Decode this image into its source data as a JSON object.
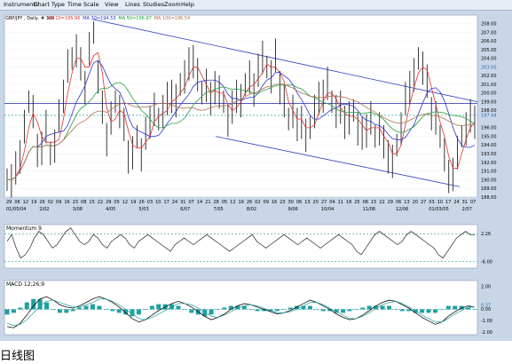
{
  "menu": [
    "Instruments",
    "Chart Type",
    "Time Scale",
    "View",
    "Lines",
    "Studies",
    "Zoom",
    "Help"
  ],
  "caption": "日线图",
  "chart_data": [
    {
      "type": "line",
      "title": "GBP/JPY , Daily, # 300",
      "legend": [
        {
          "label": "MA 10=195.96",
          "color": "#e03030"
        },
        {
          "label": "MA 30=194.53",
          "color": "#3030d0"
        },
        {
          "label": "MA 50=196.97",
          "color": "#20a040"
        },
        {
          "label": "MA 100=196.54",
          "color": "#b07050"
        }
      ],
      "price_ticks": [
        "208.00",
        "207.00",
        "206.00",
        "205.00",
        "204.00",
        "203.00",
        "202.00",
        "201.00",
        "200.00",
        "199.00",
        "198.00",
        "197.44",
        "196.00",
        "195.00",
        "194.00",
        "193.00",
        "192.00",
        "191.00",
        "190.00",
        "189.00",
        "188.00"
      ],
      "price_tick_values": [
        208,
        207,
        206,
        205,
        204,
        203,
        202,
        201,
        200,
        199,
        198,
        197.44,
        196,
        195,
        194,
        193,
        192,
        191,
        190,
        189,
        188
      ],
      "highlight_ticks": [
        "203.00",
        "197.44"
      ],
      "ylim": [
        188,
        209
      ],
      "x_ticks_days": [
        "29",
        "06",
        "12",
        "19",
        "26",
        "02",
        "09",
        "16",
        "23",
        "08",
        "15",
        "22",
        "29",
        "05",
        "12",
        "19",
        "26",
        "03",
        "10",
        "17",
        "24",
        "31",
        "07",
        "14",
        "21",
        "28",
        "05",
        "12",
        "19",
        "26",
        "02",
        "09",
        "16",
        "23",
        "30",
        "06",
        "13",
        "20",
        "27",
        "04",
        "11",
        "18",
        "25",
        "08",
        "15",
        "22",
        "29",
        "06",
        "13",
        "20",
        "27",
        "03",
        "10",
        "17",
        "24",
        "31",
        "07"
      ],
      "x_ticks_months": [
        "01/05/04",
        "2/02",
        "3/08",
        "4/05",
        "5/03",
        "6/07",
        "7/05",
        "8/02",
        "9/06",
        "10/04",
        "11/08",
        "12/06",
        "01/03/05",
        "2/07"
      ],
      "close_path": [
        190,
        190,
        191,
        193,
        196,
        199,
        198,
        193,
        194,
        196,
        193,
        194,
        197,
        200,
        203,
        204,
        205,
        203,
        201,
        205,
        207,
        202,
        198,
        195,
        197,
        199,
        198,
        196,
        193,
        193,
        195,
        193,
        195,
        197,
        198,
        197,
        198,
        199,
        200,
        199,
        201,
        202,
        203,
        204,
        202,
        200,
        201,
        199,
        201,
        200,
        199,
        197,
        198,
        200,
        199,
        201,
        202,
        200,
        203,
        204,
        203,
        202,
        204,
        201,
        199,
        197,
        198,
        196,
        197,
        195,
        196,
        198,
        199,
        200,
        201,
        199,
        198,
        198,
        197,
        197,
        198,
        196,
        195,
        196,
        197,
        195,
        196,
        194,
        193,
        192,
        194,
        196,
        199,
        201,
        202,
        204,
        203,
        201,
        198,
        197,
        195,
        193,
        190,
        191,
        193,
        195,
        196,
        197,
        197
      ],
      "channel_upper": [
        [
          0,
          208.5
        ],
        [
          1,
          199.0
        ]
      ],
      "channel_lower": [
        [
          0,
          195.0
        ],
        [
          1,
          189.2
        ]
      ],
      "horizontal_lines": [
        198.8,
        197.44
      ]
    },
    {
      "type": "line",
      "title": "Momentum 9",
      "ticks": [
        "2.26",
        "-6.00"
      ],
      "tick_values": [
        2.26,
        -6.0
      ],
      "ylim": [
        -8,
        5
      ],
      "values": [
        0,
        2,
        -2,
        -5,
        -4,
        -2,
        1,
        3,
        2,
        0,
        -2,
        -1,
        1,
        3,
        4,
        2,
        0,
        -1,
        0,
        2,
        1,
        -1,
        -2,
        0,
        1,
        2,
        1,
        -1,
        -2,
        0,
        1,
        2,
        1,
        0,
        -1,
        -2,
        -3,
        -1,
        0,
        1,
        0,
        -1,
        0,
        1,
        2,
        1,
        0,
        -1,
        -2,
        -3,
        -2,
        -1,
        0,
        1,
        2,
        0,
        -1,
        -2,
        -1,
        0,
        1,
        2,
        1,
        0,
        -1,
        0,
        1,
        0,
        -1,
        -2,
        -1,
        0,
        1,
        2,
        1,
        0,
        -1,
        -3,
        -4,
        -2,
        0,
        2,
        3,
        2,
        1,
        0,
        -1,
        0,
        2,
        3,
        2,
        1,
        0,
        -1,
        -2,
        -4,
        -5,
        -3,
        -1,
        1,
        2,
        3,
        2,
        2
      ]
    },
    {
      "type": "line",
      "title": "MACD 12;26;9",
      "ticks": [
        "2.00",
        "0.00",
        "0.37",
        "-1.00",
        "-2.00"
      ],
      "tick_values": [
        2.0,
        0.0,
        0.37,
        -1.0,
        -2.0
      ],
      "ylim": [
        -2.2,
        2.5
      ],
      "macd": [
        -1.5,
        -1.6,
        -1.2,
        -0.5,
        0.3,
        0.9,
        1.1,
        0.8,
        0.4,
        0.2,
        0.1,
        0.3,
        0.6,
        0.9,
        1.1,
        0.9,
        0.6,
        0.2,
        -0.3,
        -0.8,
        -1.1,
        -0.9,
        -0.5,
        -0.1,
        0.2,
        0.5,
        0.7,
        0.5,
        0.2,
        -0.2,
        -0.6,
        -0.9,
        -0.7,
        -0.4,
        0.0,
        0.3,
        0.5,
        0.4,
        0.2,
        0.0,
        -0.2,
        -0.4,
        -0.3,
        -0.1,
        0.2,
        0.5,
        0.8,
        0.6,
        0.3,
        0.0,
        -0.4,
        -0.7,
        -0.9,
        -0.8,
        -0.5,
        -0.1,
        0.3,
        0.6,
        0.8,
        0.7,
        0.4,
        0.1,
        -0.3,
        -0.7,
        -1.0,
        -1.3,
        -1.1,
        -0.6,
        -0.2,
        0.1,
        0.3,
        0.2
      ],
      "signal": [
        -1.2,
        -1.4,
        -1.3,
        -0.9,
        -0.3,
        0.3,
        0.7,
        0.8,
        0.6,
        0.4,
        0.2,
        0.2,
        0.4,
        0.6,
        0.9,
        0.9,
        0.7,
        0.4,
        0.0,
        -0.4,
        -0.8,
        -0.9,
        -0.7,
        -0.4,
        -0.1,
        0.2,
        0.5,
        0.5,
        0.4,
        0.1,
        -0.2,
        -0.6,
        -0.7,
        -0.5,
        -0.2,
        0.1,
        0.3,
        0.4,
        0.3,
        0.1,
        -0.1,
        -0.3,
        -0.3,
        -0.2,
        0.0,
        0.3,
        0.6,
        0.6,
        0.4,
        0.1,
        -0.2,
        -0.5,
        -0.8,
        -0.8,
        -0.6,
        -0.3,
        0.1,
        0.4,
        0.6,
        0.7,
        0.5,
        0.2,
        -0.1,
        -0.5,
        -0.8,
        -1.1,
        -1.1,
        -0.8,
        -0.4,
        -0.1,
        0.2,
        0.2
      ]
    }
  ]
}
